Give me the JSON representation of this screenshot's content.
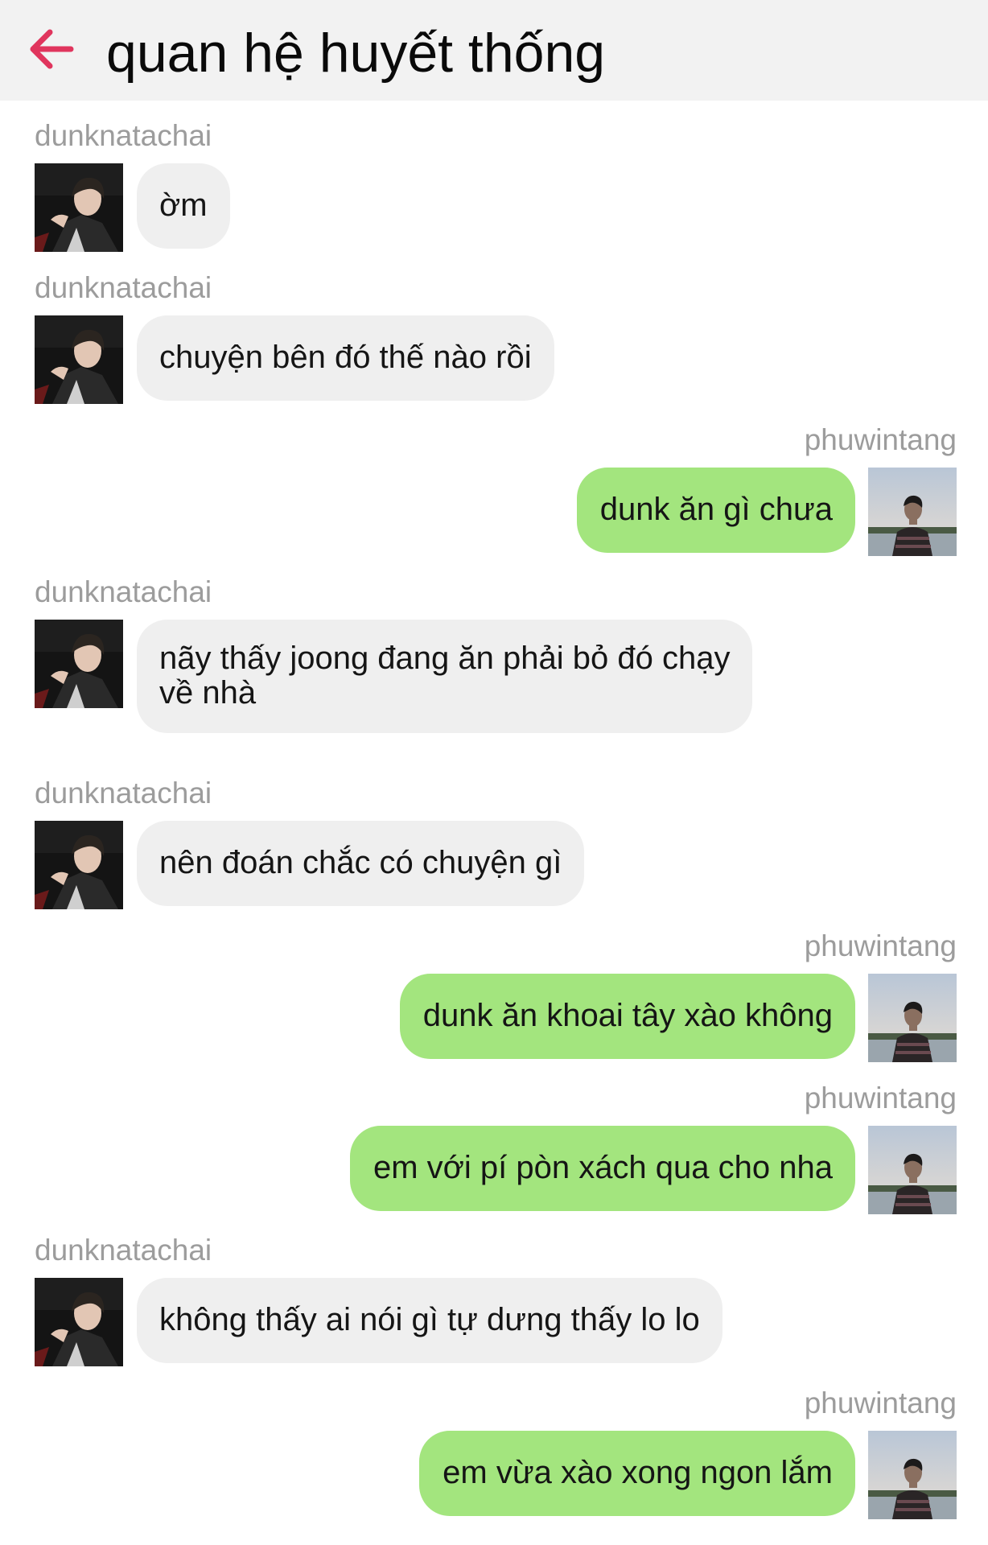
{
  "header": {
    "title": "quan hệ huyết thống",
    "back_icon": "arrow-left-icon",
    "accent_color": "#e0355d"
  },
  "colors": {
    "incoming_bubble": "#efefef",
    "outgoing_bubble": "#a3e57e",
    "sender_name": "#9c9c9c"
  },
  "messages": [
    {
      "sender": "dunknatachai",
      "direction": "in",
      "text": "ờm"
    },
    {
      "sender": "dunknatachai",
      "direction": "in",
      "text": "chuyện bên đó thế nào rồi"
    },
    {
      "sender": "phuwintang",
      "direction": "out",
      "text": "dunk ăn gì chưa"
    },
    {
      "sender": "dunknatachai",
      "direction": "in",
      "text": "nãy thấy joong đang ăn phải bỏ đó chạy\nvề nhà"
    },
    {
      "sender": "dunknatachai",
      "direction": "in",
      "text": "nên đoán chắc có chuyện gì"
    },
    {
      "sender": "phuwintang",
      "direction": "out",
      "text": "dunk ăn khoai tây xào không"
    },
    {
      "sender": "phuwintang",
      "direction": "out",
      "text": "em với pí pòn xách qua cho nha"
    },
    {
      "sender": "dunknatachai",
      "direction": "in",
      "text": "không thấy ai nói gì tự dưng thấy lo lo"
    },
    {
      "sender": "phuwintang",
      "direction": "out",
      "text": "em vừa xào xong ngon lắm"
    }
  ]
}
